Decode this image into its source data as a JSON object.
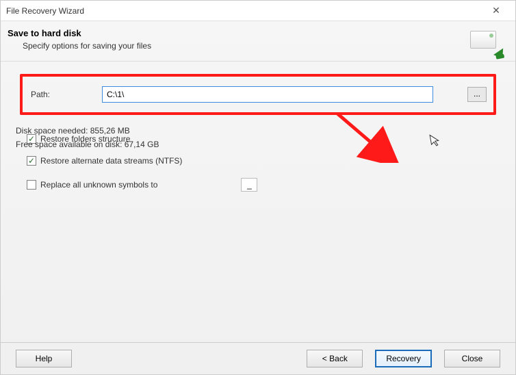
{
  "window": {
    "title": "File Recovery Wizard",
    "close": "✕"
  },
  "header": {
    "heading": "Save to hard disk",
    "subheading": "Specify options for saving your files"
  },
  "path": {
    "label": "Path:",
    "value": "C:\\1\\",
    "browse": "..."
  },
  "options": {
    "restore_folders": {
      "label": "Restore folders structure",
      "checked": true
    },
    "restore_ads": {
      "label": "Restore alternate data streams (NTFS)",
      "checked": true
    },
    "replace_symbols": {
      "label": "Replace all unknown symbols to",
      "checked": false,
      "value": "_"
    }
  },
  "diskinfo": {
    "needed": "Disk space needed: 855,26 MB",
    "free": "Free space available on disk: 67,14 GB"
  },
  "buttons": {
    "help": "Help",
    "back": "< Back",
    "recovery": "Recovery",
    "close": "Close"
  }
}
